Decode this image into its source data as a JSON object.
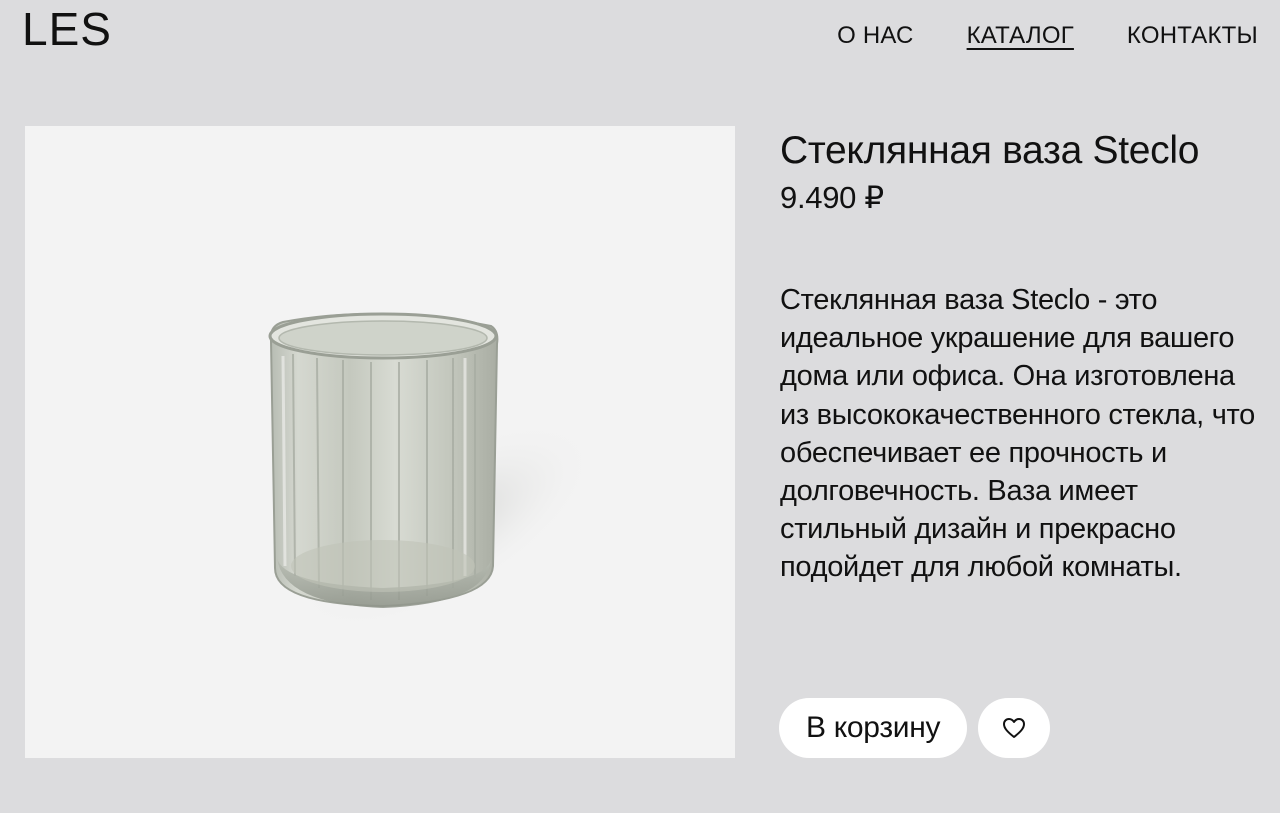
{
  "header": {
    "logo": "LES",
    "nav": [
      {
        "label": "О НАС"
      },
      {
        "label": "КАТАЛОГ",
        "active": true
      },
      {
        "label": "КОНТАКТЫ"
      }
    ]
  },
  "product": {
    "title": "Стеклянная ваза Steclo",
    "price": "9.490 ₽",
    "description": "Стеклянная ваза Steclo - это идеальное украшение для вашего дома или офиса. Она изготовлена из высококачественного стекла, что обеспечивает ее прочность и долговечность. Ваза имеет стильный дизайн и прекрасно подойдет для любой комнаты.",
    "image_icon": "glass-vase-photo"
  },
  "actions": {
    "cart_label": "В корзину",
    "favorite_icon": "heart-icon"
  },
  "colors": {
    "page_bg": "#dcdcde",
    "photo_bg": "#f3f3f3",
    "button_bg": "#ffffff",
    "text": "#111111"
  }
}
